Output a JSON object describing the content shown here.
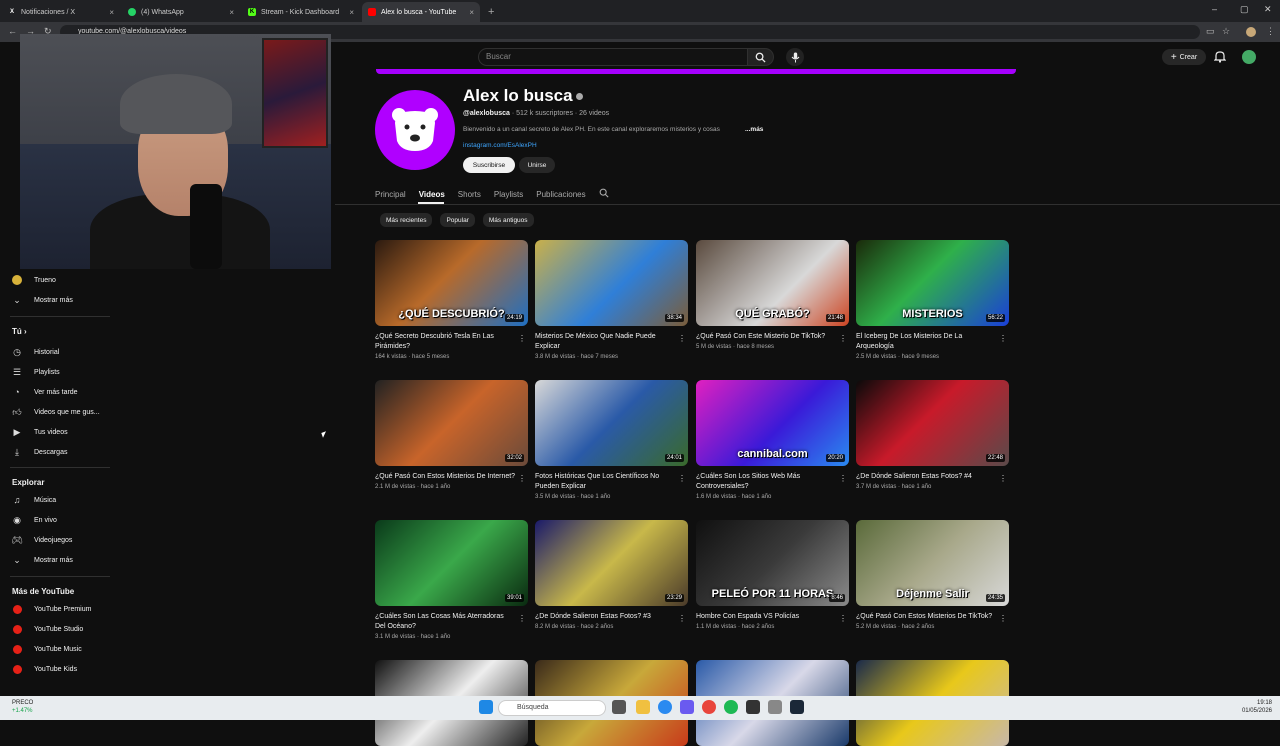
{
  "browser": {
    "tabs": [
      {
        "label": "Notificaciones / X",
        "icon": "x-logo-icon",
        "active": false
      },
      {
        "label": "(4) WhatsApp",
        "icon": "whatsapp-icon",
        "active": false
      },
      {
        "label": "Stream - Kick Dashboard",
        "icon": "kick-icon",
        "active": false
      },
      {
        "label": "Alex lo busca - YouTube",
        "icon": "youtube-icon",
        "active": true
      }
    ],
    "url": "youtube.com/@alexlobusca/videos"
  },
  "header": {
    "search_placeholder": "Buscar",
    "create_label": "Crear"
  },
  "sidebar": {
    "subs_items": [
      {
        "label": "Trueno"
      },
      {
        "label": "Mostrar más"
      }
    ],
    "you_heading": "Tú",
    "you_items": [
      {
        "label": "Historial",
        "icon": "history-icon"
      },
      {
        "label": "Playlists",
        "icon": "playlists-icon"
      },
      {
        "label": "Ver más tarde",
        "icon": "watch-later-icon"
      },
      {
        "label": "Videos que me gus...",
        "icon": "like-icon"
      },
      {
        "label": "Tus videos",
        "icon": "your-videos-icon"
      },
      {
        "label": "Descargas",
        "icon": "download-icon"
      }
    ],
    "explore_heading": "Explorar",
    "explore_items": [
      {
        "label": "Música",
        "icon": "music-icon"
      },
      {
        "label": "En vivo",
        "icon": "live-icon"
      },
      {
        "label": "Videojuegos",
        "icon": "gaming-icon"
      },
      {
        "label": "Mostrar más",
        "icon": "chevron-down-icon"
      }
    ],
    "more_heading": "Más de YouTube",
    "more_items": [
      {
        "label": "YouTube Premium"
      },
      {
        "label": "YouTube Studio"
      },
      {
        "label": "YouTube Music"
      },
      {
        "label": "YouTube Kids"
      }
    ]
  },
  "channel": {
    "name": "Alex lo busca",
    "handle": "@alexlobusca",
    "stats": "· 512 k suscriptores · 26 videos",
    "description": "Bienvenido a un canal secreto de Alex PH. En este canal exploraremos misterios y cosas",
    "more": "...más",
    "link": "instagram.com/EsAlexPH",
    "subscribe_label": "Suscribirse",
    "join_label": "Unirse",
    "accent": "#b000ff"
  },
  "channel_tabs": [
    "Principal",
    "Videos",
    "Shorts",
    "Playlists",
    "Publicaciones"
  ],
  "chips": [
    "Más recientes",
    "Popular",
    "Más antiguos"
  ],
  "videos": [
    {
      "title": "¿Qué Secreto Descubrió Tesla En Las Pirámides?",
      "meta": "164 k vistas · hace 5 meses",
      "duration": "24:19",
      "thumb_text": "¿QUÉ DESCUBRIÓ?",
      "bg": "linear-gradient(135deg,#2b1a10,#b86a2a 45%,#1f6fc2)"
    },
    {
      "title": "Misterios De México Que Nadie Puede Explicar",
      "meta": "3.8 M de vistas · hace 7 meses",
      "duration": "38:34",
      "thumb_text": "",
      "bg": "linear-gradient(135deg,#c9b04a,#2f7fd8 55%,#7a5d3a)"
    },
    {
      "title": "¿Qué Pasó Con Este Misterio De TikTok?",
      "meta": "5 M de vistas · hace 8 meses",
      "duration": "21:48",
      "thumb_text": "QUÉ GRABÓ?",
      "bg": "linear-gradient(135deg,#5a4a3e,#d8d8d8 60%,#c42)"
    },
    {
      "title": "El Iceberg De Los Misterios De La Arqueología",
      "meta": "2.5 M de vistas · hace 9 meses",
      "duration": "56:22",
      "thumb_text": "MISTERIOS",
      "bg": "linear-gradient(135deg,#1a2a0a,#2fb04a 45%,#1a3fd8)"
    },
    {
      "title": "¿Qué Pasó Con Estos Misterios De Internet?",
      "meta": "2.1 M de vistas · hace 1 año",
      "duration": "32:02",
      "thumb_text": "",
      "bg": "linear-gradient(135deg,#222,#c8642a 50%,#6a4a3a)"
    },
    {
      "title": "Fotos Históricas Que Los Científicos No Pueden Explicar",
      "meta": "3.5 M de vistas · hace 1 año",
      "duration": "24:01",
      "thumb_text": "",
      "bg": "linear-gradient(135deg,#d8d8d8,#2a5aa8 50%,#3a6a2a)"
    },
    {
      "title": "¿Cuáles Son Los Sitios Web Más Controversiales?",
      "meta": "1.6 M de vistas · hace 1 año",
      "duration": "20:20",
      "thumb_text": "cannibal.com",
      "bg": "linear-gradient(135deg,#e020c0,#3a1ad8 55%,#2a8af0)"
    },
    {
      "title": "¿De Dónde Salieron Estas Fotos? #4",
      "meta": "3.7 M de vistas · hace 1 año",
      "duration": "22:48",
      "thumb_text": "",
      "bg": "linear-gradient(135deg,#0a0a0a,#c81a2a 45%,#5a4a4a)"
    },
    {
      "title": "¿Cuáles Son Las Cosas Más Aterradoras Del Océano?",
      "meta": "3.1 M de vistas · hace 1 año",
      "duration": "39:01",
      "thumb_text": "",
      "bg": "linear-gradient(135deg,#0a3a1a,#3aa84a 50%,#0a2a10)"
    },
    {
      "title": "¿De Dónde Salieron Estas Fotos? #3",
      "meta": "8.2 M de vistas · hace 2 años",
      "duration": "23:29",
      "thumb_text": "",
      "bg": "linear-gradient(135deg,#1a1a6a,#c8b84a 50%,#4a3a2a)"
    },
    {
      "title": "Hombre Con Espada VS Policías",
      "meta": "1.1 M de vistas · hace 2 años",
      "duration": "8:46",
      "thumb_text": "PELEÓ POR 11 HORAS",
      "bg": "linear-gradient(135deg,#101010,#3a3a3a 50%,#8a8a8a)"
    },
    {
      "title": "¿Qué Pasó Con Estos Misterios De TikTok?",
      "meta": "5.2 M de vistas · hace 2 años",
      "duration": "24:35",
      "thumb_text": "Déjenme Salir",
      "bg": "linear-gradient(135deg,#5a6a3a,#a8a88a 50%,#d8d8d8)"
    },
    {
      "title": "",
      "meta": "",
      "duration": "",
      "thumb_text": "",
      "bg": "linear-gradient(135deg,#111,#eee 50%,#222)"
    },
    {
      "title": "",
      "meta": "",
      "duration": "",
      "thumb_text": "",
      "bg": "linear-gradient(135deg,#3a2a1a,#c8a83a 50%,#c83a1a)"
    },
    {
      "title": "",
      "meta": "",
      "duration": "",
      "thumb_text": "",
      "bg": "linear-gradient(135deg,#2a5aa8,#d8d8e8 50%,#1a3a6a)"
    },
    {
      "title": "",
      "meta": "",
      "duration": "",
      "thumb_text": "",
      "bg": "linear-gradient(135deg,#1a2a4a,#e8c81a 50%,#c8b8a8)"
    }
  ],
  "taskbar": {
    "search_placeholder": "Búsqueda",
    "weather_name": "PRECO",
    "weather_change": "+1.47%",
    "time": "19:18",
    "date": "01/05/2026"
  }
}
